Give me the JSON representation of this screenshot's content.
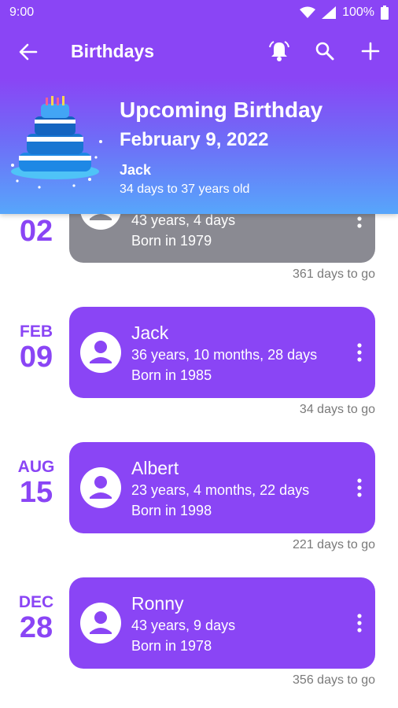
{
  "status": {
    "time": "9:00",
    "battery": "100%"
  },
  "toolbar": {
    "title": "Birthdays"
  },
  "banner": {
    "heading": "Upcoming Birthday",
    "date": "February 9, 2022",
    "name": "Jack",
    "subtitle": "34 days to 37 years old"
  },
  "entries": [
    {
      "month": "",
      "day": "02",
      "name": "",
      "age": "43 years, 4 days",
      "born": "Born in 1979",
      "to_go": "361 days to go",
      "past": true
    },
    {
      "month": "FEB",
      "day": "09",
      "name": "Jack",
      "age": "36 years, 10 months, 28 days",
      "born": "Born in 1985",
      "to_go": "34 days to go",
      "past": false
    },
    {
      "month": "AUG",
      "day": "15",
      "name": "Albert",
      "age": "23 years, 4 months, 22 days",
      "born": "Born in 1998",
      "to_go": "221 days to go",
      "past": false
    },
    {
      "month": "DEC",
      "day": "28",
      "name": "Ronny",
      "age": "43 years, 9 days",
      "born": "Born in 1978",
      "to_go": "356 days to go",
      "past": false
    }
  ],
  "colors": {
    "accent": "#8a45f5",
    "past_card": "#8a8a92",
    "banner_bottom": "#57a6fb"
  }
}
